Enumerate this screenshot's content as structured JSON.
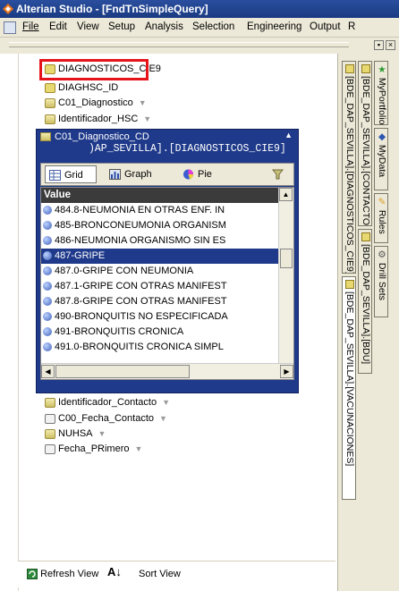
{
  "window": {
    "title": "Alterian Studio - [FndTnSimpleQuery]"
  },
  "menu": [
    "File",
    "Edit",
    "View",
    "Setup",
    "Analysis",
    "Selection",
    "Engineering",
    "Output",
    "R"
  ],
  "tree": {
    "items": [
      {
        "label": "DIAGNOSTICOS_CIE9",
        "icon": "table-icon"
      },
      {
        "label": "DIAGHSC_ID",
        "icon": "table-icon"
      },
      {
        "label": "C01_Diagnostico",
        "icon": "field-icon"
      },
      {
        "label": "Identificador_HSC",
        "icon": "field-icon"
      }
    ],
    "items_after": [
      {
        "label": "Identificador_Contacto",
        "icon": "field-icon"
      },
      {
        "label": "C00_Fecha_Contacto",
        "icon": "date-icon"
      },
      {
        "label": "NUHSA",
        "icon": "field-icon"
      },
      {
        "label": "Fecha_PRimero",
        "icon": "date-icon"
      }
    ]
  },
  "popup": {
    "title_line1": "C01_Diagnostico_CD",
    "title_line2": ")AP_SEVILLA].[DIAGNOSTICOS_CIE9]",
    "tabs": [
      {
        "label": "Grid",
        "icon": "grid-icon"
      },
      {
        "label": "Graph",
        "icon": "graph-icon"
      },
      {
        "label": "Pie",
        "icon": "pie-icon"
      }
    ],
    "column_header": "Value",
    "rows": [
      "484.8-NEUMONIA EN OTRAS ENF. IN",
      "485-BRONCONEUMONIA ORGANISM",
      "486-NEUMONIA ORGANISMO SIN ES",
      "487-GRIPE",
      "487.0-GRIPE CON NEUMONIA",
      "487.1-GRIPE CON OTRAS MANIFEST",
      "487.8-GRIPE CON OTRAS MANIFEST",
      "490-BRONQUITIS NO ESPECIFICADA",
      "491-BRONQUITIS CRONICA",
      "491.0-BRONQUITIS CRONICA SIMPL"
    ],
    "selected_row": "487-GRIPE"
  },
  "bottom": {
    "refresh": "Refresh View",
    "sort": "Sort View"
  },
  "side_tabs": {
    "col1": [
      "[BDE_DAP_SEVILLA].[DIAGNOSTICOS_CIE9]",
      "[BDE_DAP_SEVILLA].[VACUNACIONES]"
    ],
    "col2": [
      "[BDE_DAP_SEVILLA].[CONTACTOS]",
      "[BDE_DAP_SEVILLA].[BDU]"
    ],
    "col3": [
      "MyPortfolio",
      "MyData",
      "Rules",
      "Drill Sets"
    ]
  },
  "colors": {
    "title_bar": "#1b3a82",
    "selection": "#1f3a8a",
    "highlight_box": "#e5141b",
    "chrome": "#ece9d8"
  }
}
